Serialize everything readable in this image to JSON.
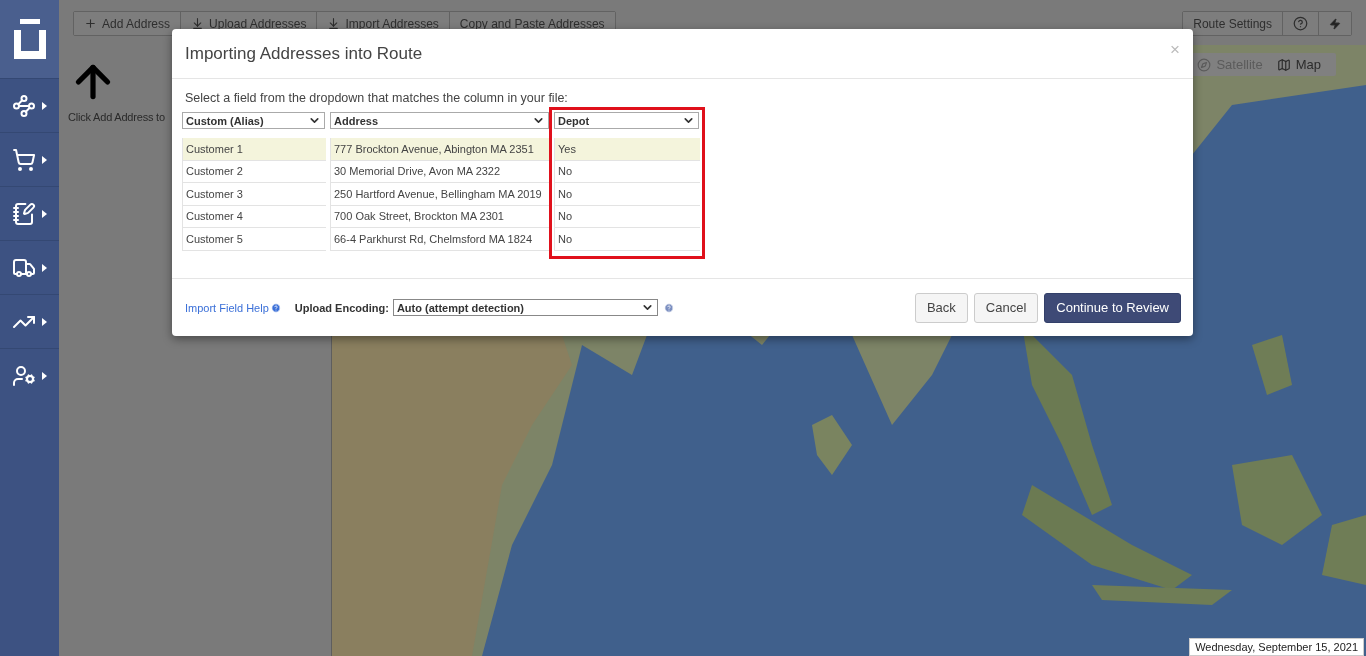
{
  "toolbar": {
    "buttons": [
      {
        "label": "Add Address",
        "kind": "add"
      },
      {
        "label": "Upload Addresses",
        "kind": "upload"
      },
      {
        "label": "Import Addresses",
        "kind": "upload"
      },
      {
        "label": "Copy and Paste Addresses",
        "kind": "text"
      }
    ],
    "right_buttons": [
      {
        "label": "Route Settings",
        "kind": "text"
      },
      {
        "kind": "help"
      },
      {
        "kind": "flash"
      }
    ]
  },
  "left_panel": {
    "hint": "Click Add Address to"
  },
  "map": {
    "layer_toggle": [
      {
        "label": "Satellite",
        "kind": "satellite",
        "selected": false
      },
      {
        "label": "Map",
        "kind": "map",
        "selected": true
      }
    ],
    "date": "Wednesday, September 15, 2021"
  },
  "modal": {
    "title": "Importing Addresses into Route",
    "close": "×",
    "instruction": "Select a field from the dropdown that matches the column in your file:",
    "table": {
      "columns": [
        {
          "field": "Custom (Alias)",
          "highlighted": false
        },
        {
          "field": "Address",
          "highlighted": false
        },
        {
          "field": "Depot",
          "highlighted": true
        }
      ],
      "rows": [
        {
          "cells": [
            "Customer 1",
            "777 Brockton Avenue, Abington MA 2351",
            "Yes"
          ],
          "selected": true
        },
        {
          "cells": [
            "Customer 2",
            "30 Memorial Drive, Avon MA 2322",
            "No"
          ],
          "selected": false
        },
        {
          "cells": [
            "Customer 3",
            "250 Hartford Avenue, Bellingham MA 2019",
            "No"
          ],
          "selected": false
        },
        {
          "cells": [
            "Customer 4",
            "700 Oak Street, Brockton MA 2301",
            "No"
          ],
          "selected": false
        },
        {
          "cells": [
            "Customer 5",
            "66-4 Parkhurst Rd, Chelmsford MA 1824",
            "No"
          ],
          "selected": false
        }
      ]
    },
    "footer": {
      "help_link": "Import Field Help",
      "encoding_label": "Upload Encoding:",
      "encoding_value": "Auto (attempt detection)",
      "buttons": [
        {
          "label": "Back",
          "kind": "default"
        },
        {
          "label": "Cancel",
          "kind": "default"
        },
        {
          "label": "Continue to Review",
          "kind": "primary"
        }
      ]
    }
  }
}
